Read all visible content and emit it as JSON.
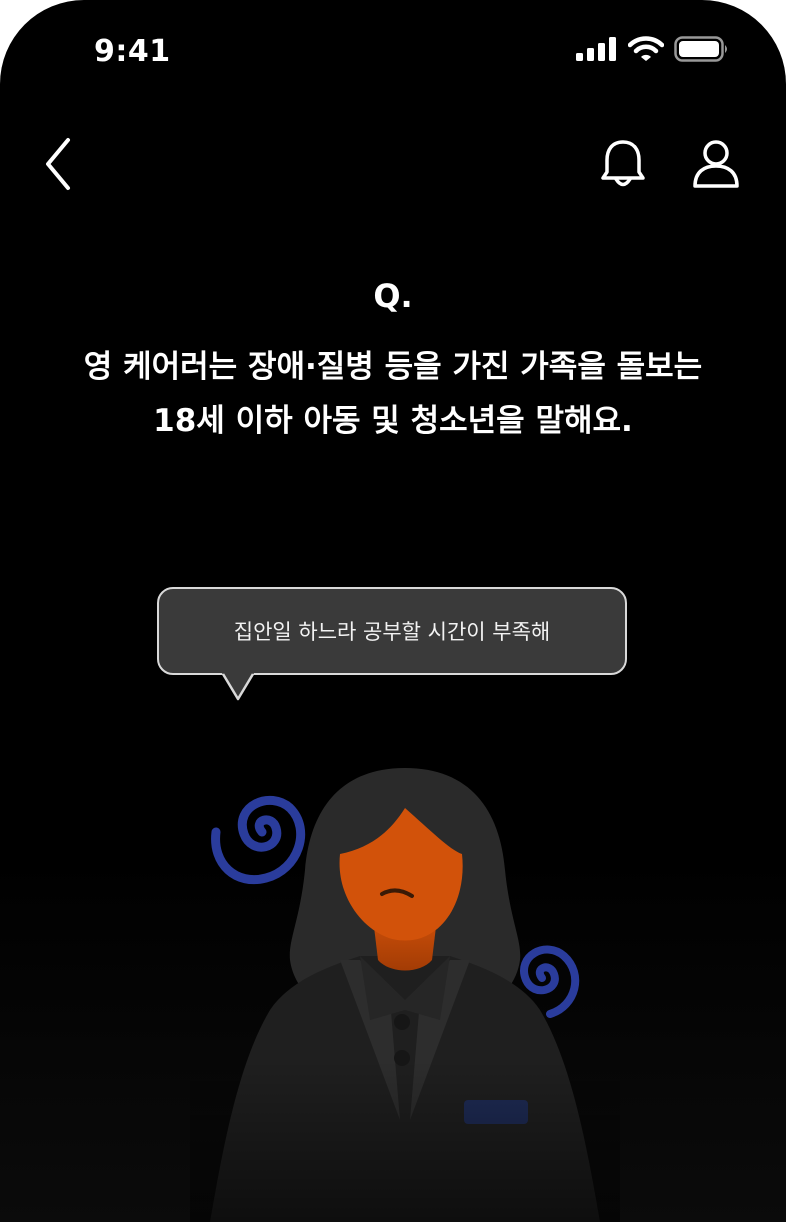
{
  "status_bar": {
    "time": "9:41",
    "icons": [
      "cellular-signal-icon",
      "wifi-icon",
      "battery-icon"
    ]
  },
  "nav": {
    "back_icon": "chevron-left-icon",
    "notification_icon": "bell-icon",
    "profile_icon": "user-icon"
  },
  "question": {
    "label": "Q.",
    "lines": [
      "영 케어러는 장애·질병 등을 가진 가족을 돌보는",
      "18세 이하 아동 및 청소년을 말해요."
    ]
  },
  "speech_bubble": {
    "text": "집안일 하느라 공부할 시간이 부족해"
  },
  "illustration": {
    "subject": "stressed-student-illustration",
    "colors": {
      "background": "#000000",
      "skin": "#d2520a",
      "hair": "#2a2a2a",
      "clothes": "#1e1e1e",
      "swirl": "#2a3c9c",
      "name_tag": "#1e2b55",
      "bubble_fill": "#3a3a3a",
      "bubble_border": "#d9d9d9"
    }
  }
}
